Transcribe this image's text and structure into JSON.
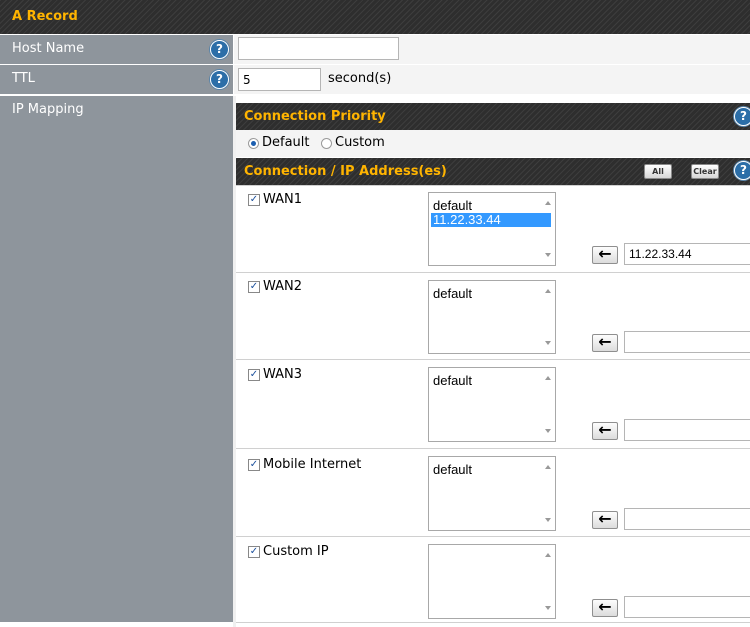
{
  "section": {
    "title": "A Record"
  },
  "fields": {
    "host_name": {
      "label": "Host Name",
      "value": "",
      "help": "?"
    },
    "ttl": {
      "label": "TTL",
      "value": "5",
      "unit": "second(s)",
      "help": "?"
    },
    "ip_mapping": {
      "label": "IP Mapping"
    }
  },
  "connection_priority": {
    "title": "Connection Priority",
    "help": "?",
    "options": [
      "Default",
      "Custom"
    ],
    "selected": "Default"
  },
  "connection_ip": {
    "title": "Connection / IP Address(es)",
    "all_label": "All",
    "clear_label": "Clear",
    "help": "?",
    "arrow_glyph": "←",
    "rows": [
      {
        "name": "WAN1",
        "checked": true,
        "items": [
          "default",
          "11.22.33.44"
        ],
        "selected": "11.22.33.44",
        "ip_value": "11.22.33.44"
      },
      {
        "name": "WAN2",
        "checked": true,
        "items": [
          "default"
        ],
        "ip_value": ""
      },
      {
        "name": "WAN3",
        "checked": true,
        "items": [
          "default"
        ],
        "ip_value": ""
      },
      {
        "name": "Mobile Internet",
        "checked": true,
        "items": [
          "default"
        ],
        "ip_value": ""
      },
      {
        "name": "Custom IP",
        "checked": true,
        "items": [],
        "ip_value": ""
      }
    ]
  },
  "colors": {
    "header_bg": "#2e2e2e",
    "header_text": "#ffb400",
    "label_bg": "#8e959c",
    "help_icon": "#2b6ea8",
    "selection": "#3399ff"
  }
}
